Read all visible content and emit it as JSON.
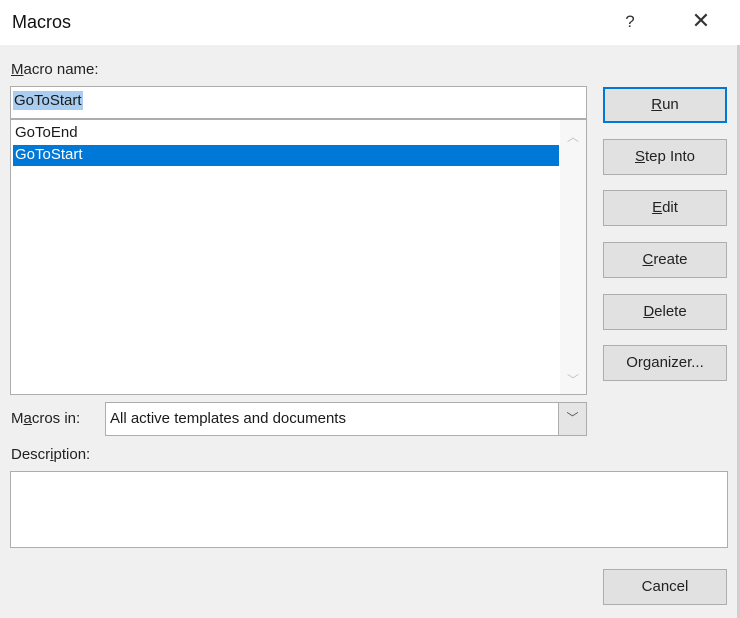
{
  "window": {
    "title": "Macros",
    "help_icon": "?",
    "close_icon": "✕"
  },
  "macro_name": {
    "label_key": "M",
    "label_rest": "acro name:",
    "value": "GoToStart"
  },
  "macro_list": {
    "items": [
      "GoToEnd",
      "GoToStart"
    ],
    "selected": "GoToStart"
  },
  "buttons": {
    "run": {
      "key": "R",
      "rest": "un"
    },
    "step_into": {
      "key": "S",
      "rest": "tep Into"
    },
    "edit": {
      "key": "E",
      "rest": "dit"
    },
    "create": {
      "key": "C",
      "rest": "reate"
    },
    "delete": {
      "key": "D",
      "rest": "elete"
    },
    "organizer": {
      "label": "Organizer..."
    },
    "cancel": {
      "label": "Cancel"
    }
  },
  "macros_in": {
    "pre": "M",
    "key": "a",
    "rest": "cros in:",
    "value": "All active templates and documents"
  },
  "description": {
    "pre": "Descr",
    "key": "i",
    "rest": "ption:",
    "value": ""
  },
  "colors": {
    "selection": "#0078d7",
    "default_border": "#0078d7"
  }
}
